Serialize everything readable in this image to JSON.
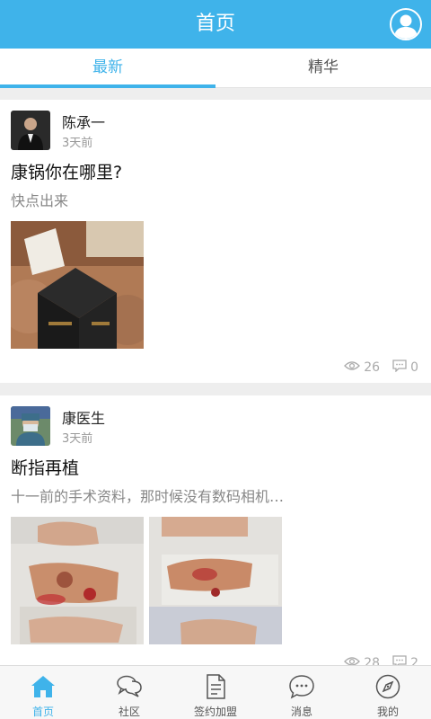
{
  "header": {
    "title": "首页"
  },
  "tabs": [
    {
      "label": "最新",
      "active": true
    },
    {
      "label": "精华",
      "active": false
    }
  ],
  "posts": [
    {
      "author": "陈承一",
      "time": "3天前",
      "title": "康锅你在哪里?",
      "excerpt": "快点出来",
      "views": "26",
      "comments": "0",
      "image_count": 1
    },
    {
      "author": "康医生",
      "time": "3天前",
      "title": "断指再植",
      "excerpt": "十一前的手术资料，那时候没有数码相机…",
      "views": "28",
      "comments": "2",
      "image_count": 2
    }
  ],
  "bottom_nav": [
    {
      "label": "首页",
      "icon": "home-icon",
      "active": true
    },
    {
      "label": "社区",
      "icon": "chat-bubbles-icon",
      "active": false
    },
    {
      "label": "签约加盟",
      "icon": "document-icon",
      "active": false
    },
    {
      "label": "消息",
      "icon": "message-icon",
      "active": false
    },
    {
      "label": "我的",
      "icon": "compass-icon",
      "active": false
    }
  ],
  "colors": {
    "accent": "#3fb3ea",
    "text_muted": "#999999",
    "background": "#eeeeee"
  }
}
